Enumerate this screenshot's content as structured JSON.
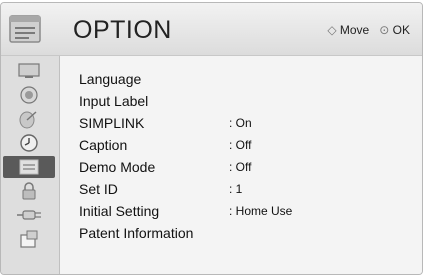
{
  "header": {
    "title": "OPTION",
    "hint_move_icon": "four-way-arrow-icon",
    "hint_move_label": "Move",
    "hint_ok_icon": "ok-button-icon",
    "hint_ok_label": "OK"
  },
  "sidebar": {
    "items": [
      {
        "icon": "picture-icon"
      },
      {
        "icon": "audio-icon"
      },
      {
        "icon": "channel-icon"
      },
      {
        "icon": "time-icon"
      },
      {
        "icon": "option-icon",
        "active": true
      },
      {
        "icon": "lock-icon"
      },
      {
        "icon": "input-icon"
      },
      {
        "icon": "usb-icon"
      }
    ]
  },
  "menu": {
    "items": [
      {
        "label": "Language",
        "value": ""
      },
      {
        "label": "Input Label",
        "value": ""
      },
      {
        "label": "SIMPLINK",
        "value": ": On"
      },
      {
        "label": "Caption",
        "value": ": Off"
      },
      {
        "label": "Demo Mode",
        "value": ": Off"
      },
      {
        "label": "Set ID",
        "value": ": 1"
      },
      {
        "label": "Initial Setting",
        "value": ": Home Use"
      },
      {
        "label": "Patent Information",
        "value": ""
      }
    ]
  },
  "colors": {
    "header_bg": "#e4e4e4",
    "content_bg": "#f4f4f4",
    "sidebar_active": "#5a5a5a"
  }
}
